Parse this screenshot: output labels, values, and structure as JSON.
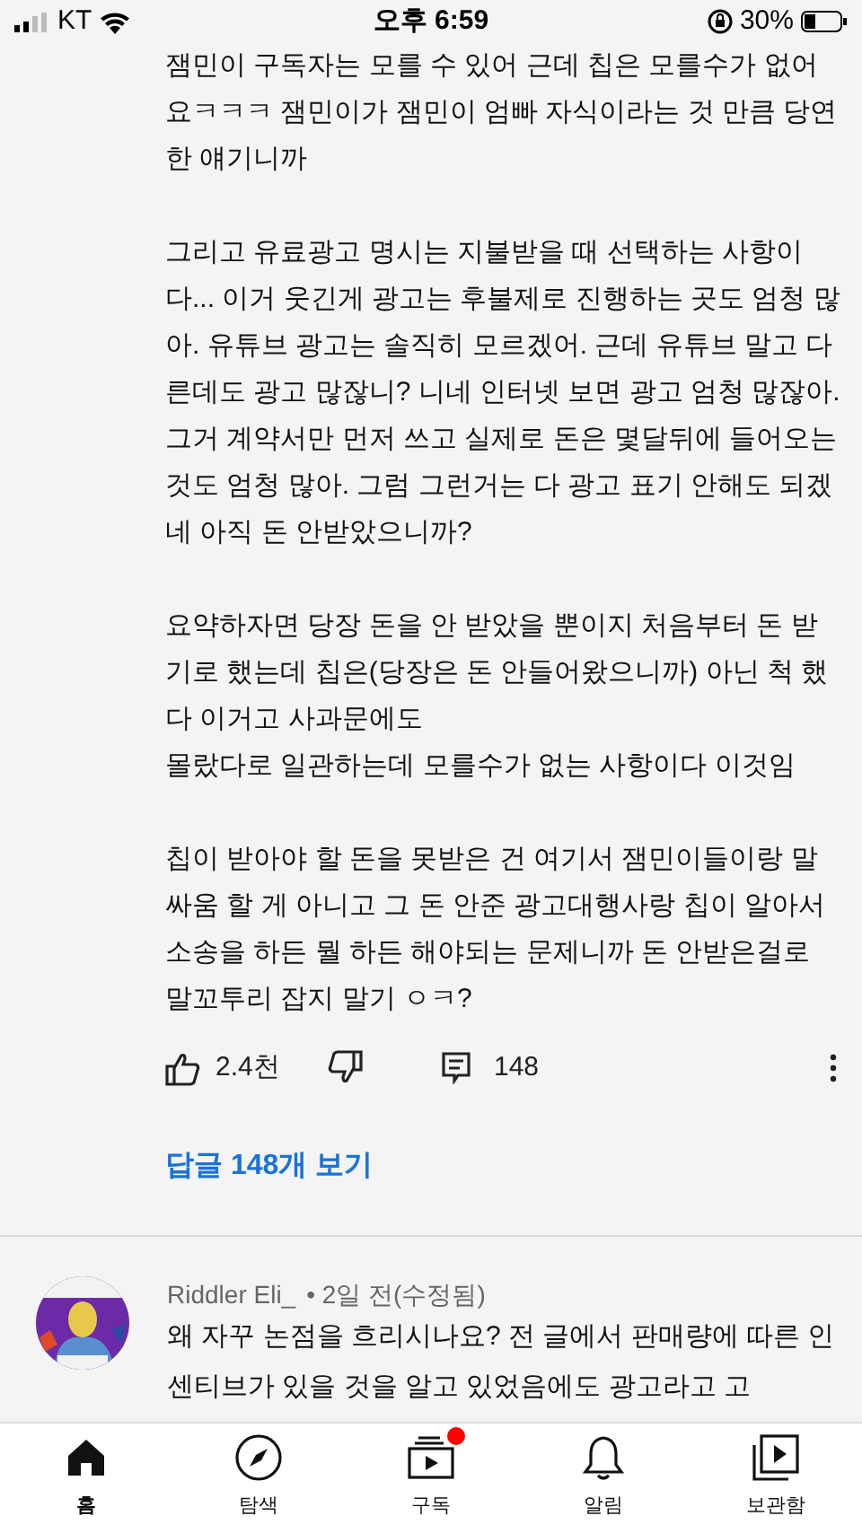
{
  "status_bar": {
    "carrier": "KT",
    "time": "오후 6:59",
    "battery": "30%"
  },
  "comment": {
    "paragraphs": [
      "잼민이 구독자는 모를 수 있어 근데 칩은 모를수가 없어요ㅋㅋㅋ 잼민이가 잼민이 엄빠 자식이라는 것 만큼 당연한 얘기니까",
      "그리고 유료광고 명시는 지불받을 때 선택하는 사항이다... 이거 웃긴게 광고는 후불제로 진행하는 곳도 엄청 많아. 유튜브 광고는 솔직히 모르겠어. 근데 유튜브 말고 다른데도 광고 많잖니? 니네 인터넷 보면 광고 엄청 많잖아. 그거 계약서만 먼저 쓰고 실제로 돈은 몇달뒤에 들어오는 것도 엄청 많아. 그럼 그런거는 다 광고 표기 안해도 되겠네 아직 돈 안받았으니까?",
      "요약하자면 당장 돈을 안 받았을 뿐이지 처음부터 돈 받기로 했는데 칩은(당장은 돈 안들어왔으니까) 아닌 척 했다 이거고 사과문에도\n몰랐다로 일관하는데 모를수가 없는 사항이다 이것임",
      "칩이 받아야 할 돈을 못받은 건 여기서 잼민이들이랑 말싸움 할 게 아니고 그 돈 안준 광고대행사랑 칩이 알아서 소송을 하든 뭘 하든 해야되는 문제니까 돈 안받은걸로 말꼬투리 잡지 말기 ㅇㅋ?"
    ],
    "likes": "2.4천",
    "replies": "148",
    "view_replies": "답글 148개 보기"
  },
  "next_comment": {
    "author": "Riddler Eli_",
    "meta": "• 2일 전(수정됨)",
    "text": "왜 자꾸 논점을 흐리시나요? 전 글에서 판매량에 따른 인센티브가 있을 것을 알고 있었음에도 광고라고 고"
  },
  "nav": [
    {
      "kind": "home",
      "label": "홈",
      "selected": true,
      "badge": false
    },
    {
      "kind": "explore",
      "label": "탐색",
      "selected": false,
      "badge": false
    },
    {
      "kind": "subs",
      "label": "구독",
      "selected": false,
      "badge": true
    },
    {
      "kind": "bell",
      "label": "알림",
      "selected": false,
      "badge": false
    },
    {
      "kind": "library",
      "label": "보관함",
      "selected": false,
      "badge": false
    }
  ]
}
